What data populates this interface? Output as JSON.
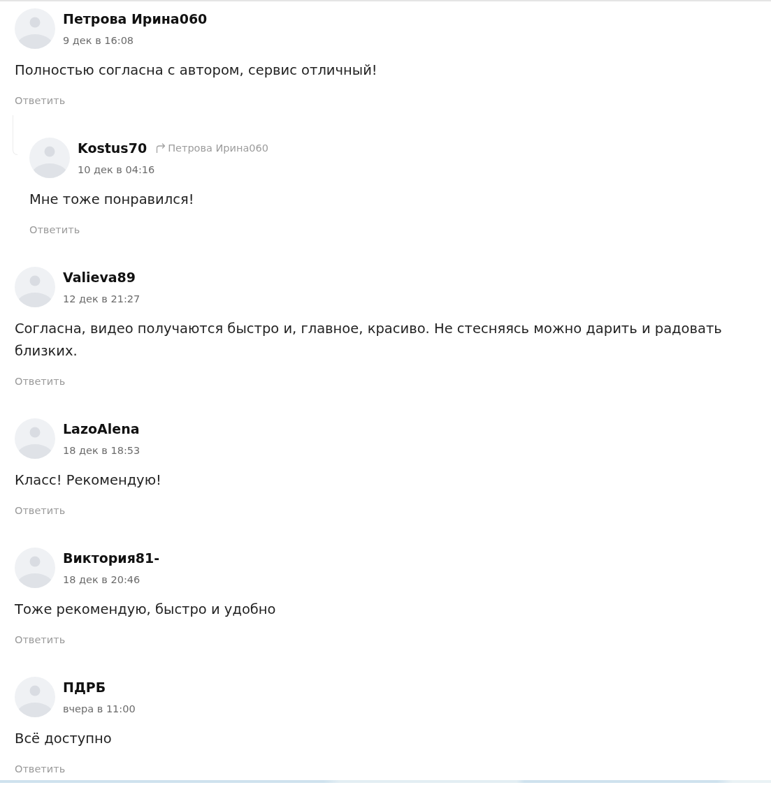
{
  "comments": [
    {
      "author": "Петрова Ирина060",
      "date": "9 дек в 16:08",
      "text": "Полностью согласна с автором, сервис отличный!",
      "reply_button": "Ответить",
      "children": [
        {
          "author": "Kostus70",
          "reply_to": "Петрова Ирина060",
          "date": "10 дек в 04:16",
          "text": "Мне тоже понравился!",
          "reply_button": "Ответить"
        }
      ]
    },
    {
      "author": "Valieva89",
      "date": "12 дек в 21:27",
      "text": "Согласна, видео получаются быстро и, главное, красиво. Не стесняясь можно дарить и радовать близких.",
      "reply_button": "Ответить"
    },
    {
      "author": "LazoAlena",
      "date": "18 дек в 18:53",
      "text": "Класс! Рекомендую!",
      "reply_button": "Ответить"
    },
    {
      "author": "Виктория81-",
      "date": "18 дек в 20:46",
      "text": "Тоже рекомендую, быстро и удобно",
      "reply_button": "Ответить"
    },
    {
      "author": "ПДРБ",
      "date": "вчера в 11:00",
      "text": "Всё доступно",
      "reply_button": "Ответить"
    }
  ]
}
